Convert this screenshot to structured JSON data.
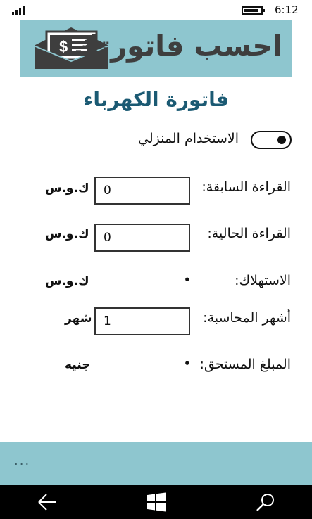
{
  "status": {
    "time": "6:12"
  },
  "banner": {
    "title": "احسب فاتورتك"
  },
  "page": {
    "title": "فاتورة الكهرباء"
  },
  "usage_toggle": {
    "label": "الاستخدام المنزلي",
    "state": "on"
  },
  "previous_reading": {
    "label": "القراءة السابقة:",
    "value": "0",
    "unit": "ك.و.س"
  },
  "current_reading": {
    "label": "القراءة الحالية:",
    "value": "0",
    "unit": "ك.و.س"
  },
  "consumption": {
    "label": "الاستهلاك:",
    "value": "•",
    "unit": "ك.و.س"
  },
  "billing_months": {
    "label": "أشهر المحاسبة:",
    "value": "1",
    "unit": "شهر"
  },
  "amount_due": {
    "label": "المبلغ المستحق:",
    "value": "•",
    "unit": "جنيه"
  },
  "appbar": {
    "more_label": "..."
  },
  "icons": {
    "signal": "signal-icon",
    "battery": "battery-icon",
    "back": "back-arrow-icon",
    "start": "windows-start-icon",
    "search": "search-icon"
  }
}
